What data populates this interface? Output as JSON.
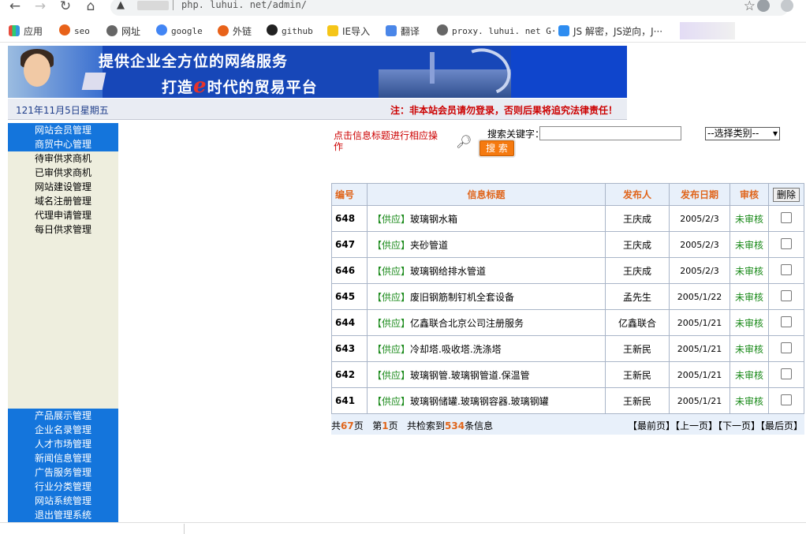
{
  "browser": {
    "url": "php. luhui. net/admin/",
    "bookmarks": [
      "应用",
      "seo",
      "网址",
      "google",
      "外链",
      "github",
      "IE导入",
      "翻译",
      "proxy. luhui. net G···",
      "JS 解密，JS逆向，J···"
    ]
  },
  "banner": {
    "slogan1": "提供企业全方位的网络服务",
    "slogan2_pre": "打造",
    "slogan2_e": "e",
    "slogan2_post": "时代的贸易平台",
    "date": "121年11月5日星期五",
    "notice": "注：非本站会员请勿登录，否则后果将追究法律责任！"
  },
  "sidebar": {
    "top": [
      "网站会员管理",
      "商贸中心管理"
    ],
    "sub": [
      "待审供求商机",
      "已审供求商机",
      "网站建设管理",
      "域名注册管理",
      "代理申请管理",
      "每日供求管理"
    ],
    "bottom": [
      "产品展示管理",
      "企业名录管理",
      "人才市场管理",
      "新闻信息管理",
      "广告服务管理",
      "行业分类管理",
      "网站系统管理",
      "退出管理系统"
    ]
  },
  "search": {
    "tip": "点击信息标题进行相应操作",
    "label": "搜索关键字：",
    "value": "",
    "category": "--选择类别--",
    "button": "搜 索"
  },
  "table": {
    "headers": [
      "编号",
      "信息标题",
      "发布人",
      "发布日期",
      "审核",
      "删除"
    ],
    "rows": [
      {
        "id": "648",
        "tag": "【供应】",
        "title": "玻璃钢水箱",
        "publisher": "王庆成",
        "date": "2005/2/3",
        "status": "未审核"
      },
      {
        "id": "647",
        "tag": "【供应】",
        "title": "夹砂管道",
        "publisher": "王庆成",
        "date": "2005/2/3",
        "status": "未审核"
      },
      {
        "id": "646",
        "tag": "【供应】",
        "title": "玻璃钢给排水管道",
        "publisher": "王庆成",
        "date": "2005/2/3",
        "status": "未审核"
      },
      {
        "id": "645",
        "tag": "【供应】",
        "title": "废旧钢筋制钉机全套设备",
        "publisher": "孟先生",
        "date": "2005/1/22",
        "status": "未审核"
      },
      {
        "id": "644",
        "tag": "【供应】",
        "title": "亿鑫联合北京公司注册服务",
        "publisher": "亿鑫联合",
        "date": "2005/1/21",
        "status": "未审核"
      },
      {
        "id": "643",
        "tag": "【供应】",
        "title": "冷却塔.吸收塔.洗涤塔",
        "publisher": "王新民",
        "date": "2005/1/21",
        "status": "未审核"
      },
      {
        "id": "642",
        "tag": "【供应】",
        "title": "玻璃钢管.玻璃钢管道.保温管",
        "publisher": "王新民",
        "date": "2005/1/21",
        "status": "未审核"
      },
      {
        "id": "641",
        "tag": "【供应】",
        "title": "玻璃钢储罐.玻璃钢容器.玻璃钢罐",
        "publisher": "王新民",
        "date": "2005/1/21",
        "status": "未审核"
      }
    ]
  },
  "pager": {
    "total_pages_pre": "共",
    "total_pages": "67",
    "total_pages_post": "页",
    "current_pre": "第",
    "current": "1",
    "current_post": "页",
    "count_pre": "共检索到",
    "count": "534",
    "count_post": "条信息",
    "first": "【最前页】",
    "prev": "【上一页】",
    "next": "【下一页】",
    "last": "【最后页】"
  }
}
